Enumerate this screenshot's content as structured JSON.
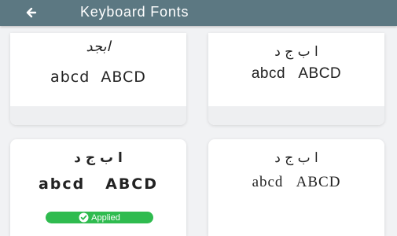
{
  "appbar": {
    "title": "Keyboard Fonts",
    "back_icon": "back-arrow-icon",
    "color": "#5c7882"
  },
  "fonts": [
    {
      "arabic": "ابجد",
      "latin": "abcd  ABCD"
    },
    {
      "arabic": "ا ب ج د",
      "latin": "abcd   ABCD"
    },
    {
      "arabic": "ا ب ج د",
      "latin": "abcd   ABCD"
    },
    {
      "arabic": "ا ب ج د",
      "latin": "abcd   ABCD"
    }
  ],
  "applied_badge": {
    "label": "Applied",
    "icon": "check-circle-icon",
    "color": "#2fbb4f"
  }
}
